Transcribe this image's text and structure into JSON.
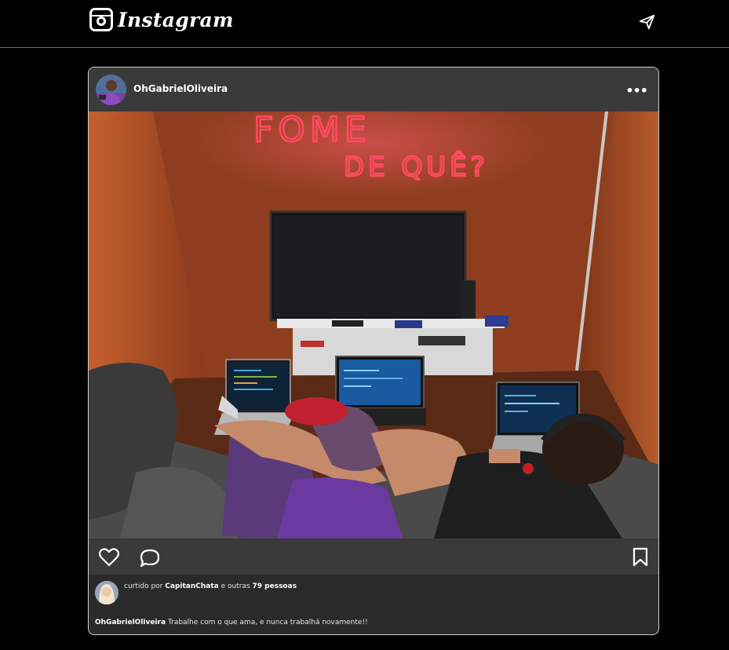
{
  "header": {
    "logo_text": "Instagram",
    "send_icon": "paper-plane-icon"
  },
  "post": {
    "username": "OhGabrielOliveira",
    "more_icon": "more-dots-icon",
    "more_label": "•••",
    "image": {
      "neon_line1": "FOME",
      "neon_line2": "DE QUÊ?",
      "neon_color": "#ff3b52"
    },
    "actions": {
      "like_icon": "heart-icon",
      "comment_icon": "comment-icon",
      "save_icon": "bookmark-icon"
    },
    "likes": {
      "prefix": "curtido por",
      "liked_by": "CapitanChata",
      "middle": "e outras",
      "count": "79 pessoas"
    },
    "caption": {
      "user": "OhGabrielOliveira",
      "text": "Trabalhe com o que ama, e nunca trabalhá novamente!!"
    }
  },
  "colors": {
    "background": "#000000",
    "card": "#2a2a2a",
    "card_header": "#3a3a3a",
    "wood": "#a8502a"
  }
}
